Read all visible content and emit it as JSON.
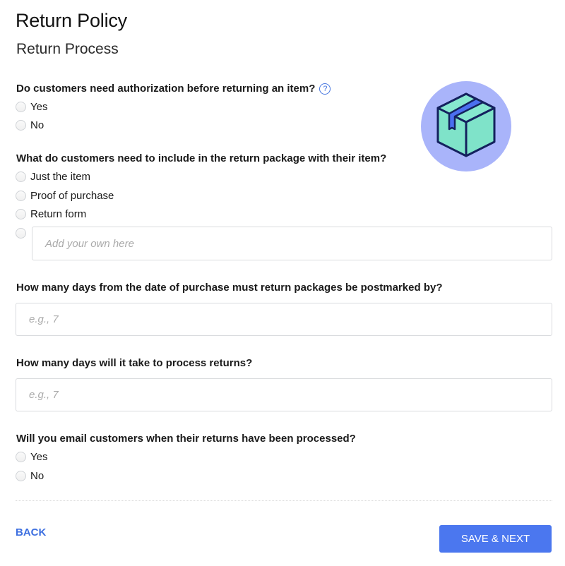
{
  "header": {
    "title": "Return Policy",
    "subtitle": "Return Process"
  },
  "questions": {
    "authorization": {
      "label": "Do customers need authorization before returning an item?",
      "help_icon": "?",
      "options": [
        "Yes",
        "No"
      ]
    },
    "package_contents": {
      "label": "What do customers need to include in the return package with their item?",
      "options": [
        "Just the item",
        "Proof of purchase",
        "Return form"
      ],
      "custom_placeholder": "Add your own here"
    },
    "postmark_days": {
      "label": "How many days from the date of purchase must return packages be postmarked by?",
      "placeholder": "e.g., 7"
    },
    "process_days": {
      "label": "How many days will it take to process returns?",
      "placeholder": "e.g., 7"
    },
    "email_customers": {
      "label": "Will you email customers when their returns have been processed?",
      "options": [
        "Yes",
        "No"
      ]
    }
  },
  "footer": {
    "back_label": "BACK",
    "save_label": "SAVE & NEXT"
  },
  "colors": {
    "accent": "#4b77ef",
    "link": "#3d6fe0",
    "illustration_circle": "#a9b4fa",
    "box_fill": "#7fe3c9",
    "tape": "#4b6ff0",
    "outline": "#14215e"
  }
}
